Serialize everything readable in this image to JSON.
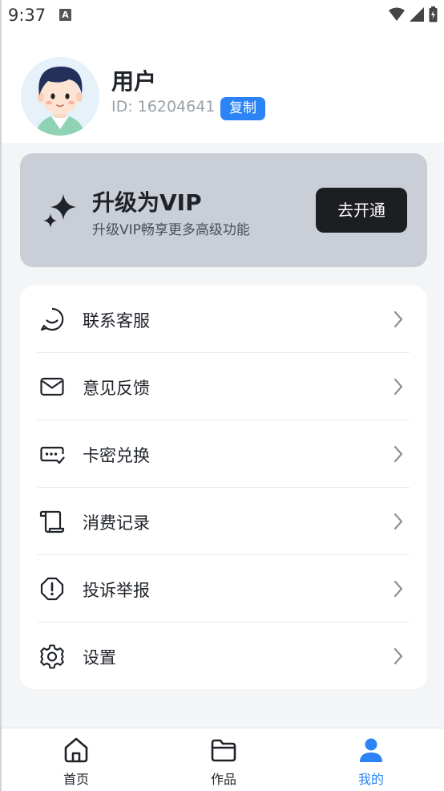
{
  "status_bar": {
    "time": "9:37",
    "notification_icon": "A"
  },
  "profile": {
    "name": "用户",
    "id_text": "ID: 16204641",
    "copy_label": "复制",
    "avatar_icon": "avatar-illustration"
  },
  "vip": {
    "title": "升级为VIP",
    "subtitle": "升级VIP畅享更多高级功能",
    "button_label": "去开通",
    "icon": "sparkle-icon"
  },
  "menu": {
    "items": [
      {
        "label": "联系客服",
        "icon": "chat-bubble-icon"
      },
      {
        "label": "意见反馈",
        "icon": "mail-icon"
      },
      {
        "label": "卡密兑换",
        "icon": "card-code-icon"
      },
      {
        "label": "消费记录",
        "icon": "scroll-icon"
      },
      {
        "label": "投诉举报",
        "icon": "alert-circle-icon"
      },
      {
        "label": "设置",
        "icon": "gear-icon"
      }
    ]
  },
  "bottom_nav": {
    "items": [
      {
        "label": "首页",
        "icon": "home-icon",
        "active": false
      },
      {
        "label": "作品",
        "icon": "folder-icon",
        "active": false
      },
      {
        "label": "我的",
        "icon": "user-icon",
        "active": true
      }
    ]
  },
  "colors": {
    "accent": "#2b83f6",
    "vip_card": "#c9ced7",
    "vip_button": "#1c1e21",
    "background": "#f4f5f7"
  }
}
